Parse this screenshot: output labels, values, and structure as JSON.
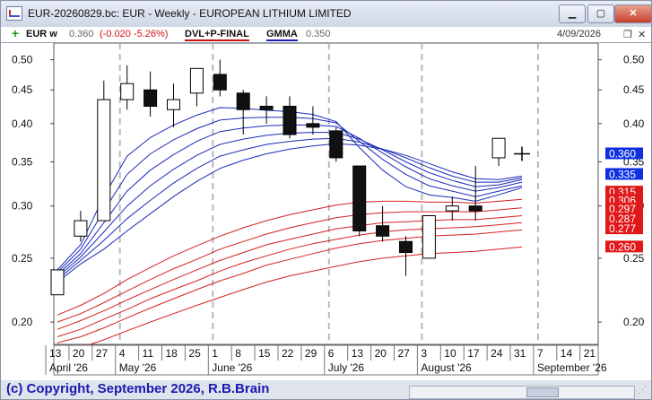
{
  "window": {
    "title": "EUR-20260829.bc: EUR - Weekly - EUROPEAN LITHIUM LIMITED",
    "minimize_label": "▁",
    "maximize_label": "▢",
    "close_label": "✕"
  },
  "infobar": {
    "symbol": "EUR w",
    "price": "0.360",
    "change": "(-0.020 -5.26%)",
    "indicator1": "DVL+P-FINAL",
    "indicator2": "GMMA",
    "indicator2_value": "0.350",
    "date": "4/09/2026",
    "restore_label": "❐",
    "close_label": "✕"
  },
  "colors": {
    "short_ema": "#1a2bb8",
    "long_ema": "#d42020",
    "price_tag_blue": "#1030e0",
    "price_tag_red": "#e01818"
  },
  "footer": {
    "copyright": "(c) Copyright, September 2026, R.B.Brain"
  },
  "chart_data": {
    "type": "candlestick",
    "scale": "log",
    "ylim": [
      0.185,
      0.53
    ],
    "y_ticks": [
      0.5,
      0.45,
      0.4,
      0.35,
      0.3,
      0.25,
      0.2
    ],
    "x_day_labels": [
      "13",
      "20",
      "27",
      "4",
      "11",
      "18",
      "25",
      "1",
      "8",
      "15",
      "22",
      "29",
      "6",
      "13",
      "20",
      "27",
      "3",
      "10",
      "17",
      "24",
      "31",
      "7",
      "14",
      "21"
    ],
    "x_month_labels": [
      "April '26",
      "May '26",
      "June '26",
      "July '26",
      "August '26",
      "September '26"
    ],
    "candles": [
      {
        "o": 0.22,
        "h": 0.24,
        "l": 0.22,
        "c": 0.24
      },
      {
        "o": 0.27,
        "h": 0.295,
        "l": 0.265,
        "c": 0.285
      },
      {
        "o": 0.285,
        "h": 0.465,
        "l": 0.285,
        "c": 0.435
      },
      {
        "o": 0.435,
        "h": 0.49,
        "l": 0.42,
        "c": 0.46
      },
      {
        "o": 0.45,
        "h": 0.48,
        "l": 0.41,
        "c": 0.425
      },
      {
        "o": 0.42,
        "h": 0.46,
        "l": 0.395,
        "c": 0.435
      },
      {
        "o": 0.445,
        "h": 0.485,
        "l": 0.425,
        "c": 0.485
      },
      {
        "o": 0.475,
        "h": 0.5,
        "l": 0.44,
        "c": 0.45
      },
      {
        "o": 0.445,
        "h": 0.45,
        "l": 0.385,
        "c": 0.42
      },
      {
        "o": 0.425,
        "h": 0.44,
        "l": 0.4,
        "c": 0.42
      },
      {
        "o": 0.425,
        "h": 0.44,
        "l": 0.38,
        "c": 0.385
      },
      {
        "o": 0.4,
        "h": 0.425,
        "l": 0.385,
        "c": 0.395
      },
      {
        "o": 0.39,
        "h": 0.395,
        "l": 0.35,
        "c": 0.355
      },
      {
        "o": 0.345,
        "h": 0.345,
        "l": 0.27,
        "c": 0.275
      },
      {
        "o": 0.28,
        "h": 0.3,
        "l": 0.265,
        "c": 0.27
      },
      {
        "o": 0.265,
        "h": 0.27,
        "l": 0.235,
        "c": 0.255
      },
      {
        "o": 0.25,
        "h": 0.29,
        "l": 0.25,
        "c": 0.29
      },
      {
        "o": 0.295,
        "h": 0.31,
        "l": 0.285,
        "c": 0.3
      },
      {
        "o": 0.3,
        "h": 0.345,
        "l": 0.285,
        "c": 0.295
      },
      {
        "o": 0.355,
        "h": 0.38,
        "l": 0.345,
        "c": 0.38
      },
      {
        "o": 0.36,
        "h": 0.36,
        "l": 0.36,
        "c": 0.36
      }
    ],
    "short_emas": [
      [
        0.24,
        0.262,
        0.31,
        0.357,
        0.381,
        0.398,
        0.412,
        0.423,
        0.422,
        0.419,
        0.417,
        0.413,
        0.403,
        0.368,
        0.34,
        0.321,
        0.312,
        0.309,
        0.305,
        0.312,
        0.32
      ],
      [
        0.238,
        0.258,
        0.295,
        0.335,
        0.36,
        0.378,
        0.393,
        0.405,
        0.408,
        0.409,
        0.409,
        0.407,
        0.401,
        0.376,
        0.353,
        0.335,
        0.322,
        0.316,
        0.31,
        0.316,
        0.322
      ],
      [
        0.236,
        0.254,
        0.283,
        0.316,
        0.34,
        0.359,
        0.376,
        0.389,
        0.394,
        0.397,
        0.398,
        0.398,
        0.396,
        0.38,
        0.361,
        0.344,
        0.33,
        0.322,
        0.316,
        0.32,
        0.326
      ],
      [
        0.234,
        0.251,
        0.274,
        0.3,
        0.322,
        0.341,
        0.358,
        0.372,
        0.379,
        0.384,
        0.387,
        0.388,
        0.388,
        0.379,
        0.365,
        0.35,
        0.337,
        0.328,
        0.321,
        0.323,
        0.329
      ],
      [
        0.232,
        0.248,
        0.266,
        0.287,
        0.306,
        0.325,
        0.342,
        0.357,
        0.365,
        0.372,
        0.376,
        0.379,
        0.38,
        0.375,
        0.366,
        0.355,
        0.343,
        0.333,
        0.326,
        0.326,
        0.331
      ],
      [
        0.23,
        0.245,
        0.258,
        0.275,
        0.292,
        0.31,
        0.327,
        0.342,
        0.352,
        0.36,
        0.366,
        0.37,
        0.373,
        0.371,
        0.366,
        0.358,
        0.348,
        0.338,
        0.33,
        0.329,
        0.333
      ]
    ],
    "long_emas": [
      [
        0.205,
        0.212,
        0.221,
        0.232,
        0.242,
        0.252,
        0.261,
        0.27,
        0.278,
        0.285,
        0.291,
        0.296,
        0.301,
        0.304,
        0.305,
        0.305,
        0.304,
        0.304,
        0.303,
        0.305,
        0.307
      ],
      [
        0.2,
        0.206,
        0.214,
        0.223,
        0.232,
        0.241,
        0.249,
        0.258,
        0.265,
        0.272,
        0.278,
        0.283,
        0.288,
        0.291,
        0.293,
        0.294,
        0.294,
        0.294,
        0.294,
        0.296,
        0.298
      ],
      [
        0.195,
        0.201,
        0.208,
        0.216,
        0.224,
        0.232,
        0.24,
        0.248,
        0.255,
        0.262,
        0.267,
        0.272,
        0.277,
        0.28,
        0.283,
        0.284,
        0.285,
        0.286,
        0.286,
        0.288,
        0.29
      ],
      [
        0.19,
        0.195,
        0.202,
        0.209,
        0.217,
        0.224,
        0.231,
        0.239,
        0.246,
        0.252,
        0.258,
        0.263,
        0.267,
        0.271,
        0.274,
        0.276,
        0.277,
        0.278,
        0.279,
        0.281,
        0.283
      ],
      [
        0.186,
        0.19,
        0.196,
        0.203,
        0.21,
        0.217,
        0.224,
        0.231,
        0.237,
        0.244,
        0.249,
        0.254,
        0.259,
        0.263,
        0.266,
        0.268,
        0.27,
        0.271,
        0.272,
        0.274,
        0.276
      ],
      [
        0.179,
        0.183,
        0.188,
        0.194,
        0.2,
        0.206,
        0.212,
        0.218,
        0.224,
        0.23,
        0.235,
        0.239,
        0.243,
        0.247,
        0.25,
        0.252,
        0.254,
        0.255,
        0.256,
        0.258,
        0.26
      ]
    ],
    "price_tags_blue": [
      "0.360",
      "0.335"
    ],
    "price_tags_red": [
      "0.315",
      "0.306",
      "0.297",
      "0.287",
      "0.277",
      "0.260"
    ],
    "price_tag_blue_values": [
      0.36,
      0.335
    ],
    "price_tag_red_values": [
      0.315,
      0.306,
      0.297,
      0.287,
      0.277,
      0.26
    ],
    "cursor_value": 0.362
  }
}
